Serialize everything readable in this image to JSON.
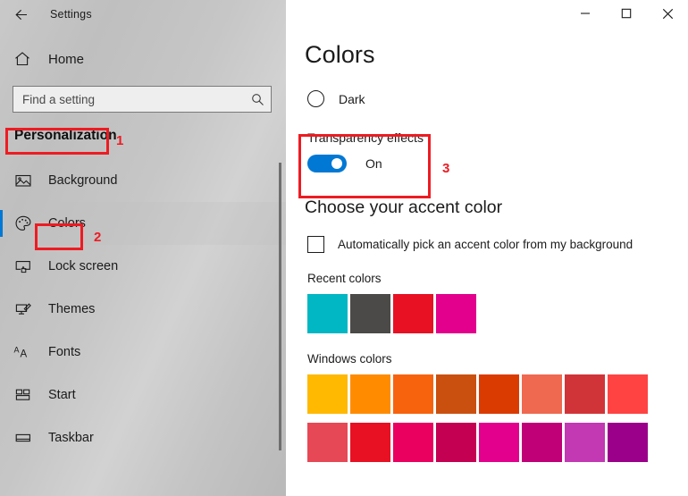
{
  "window": {
    "title": "Settings",
    "back_icon": "back-arrow-icon",
    "minimize_label": "—",
    "maximize_label": "□",
    "close_label": "✕"
  },
  "sidebar": {
    "home": {
      "label": "Home",
      "icon": "home-icon"
    },
    "search": {
      "placeholder": "Find a setting",
      "value": "",
      "icon": "search-icon"
    },
    "category_title": "Personalization",
    "items": [
      {
        "label": "Background",
        "icon": "picture-icon",
        "selected": false
      },
      {
        "label": "Colors",
        "icon": "palette-icon",
        "selected": true
      },
      {
        "label": "Lock screen",
        "icon": "lock-screen-icon",
        "selected": false
      },
      {
        "label": "Themes",
        "icon": "themes-brush-icon",
        "selected": false
      },
      {
        "label": "Fonts",
        "icon": "fonts-aa-icon",
        "selected": false
      },
      {
        "label": "Start",
        "icon": "start-tiles-icon",
        "selected": false
      },
      {
        "label": "Taskbar",
        "icon": "taskbar-icon",
        "selected": false
      }
    ]
  },
  "main": {
    "page_title": "Colors",
    "dark_option": {
      "label": "Dark",
      "checked": false
    },
    "transparency": {
      "label": "Transparency effects",
      "state_label": "On",
      "on": true,
      "accent": "#0078d4"
    },
    "accent_section": {
      "heading": "Choose your accent color",
      "auto_pick": {
        "label": "Automatically pick an accent color from my background",
        "checked": false
      },
      "recent_colors": {
        "label": "Recent colors",
        "swatches": [
          "#00b7c3",
          "#4c4a48",
          "#e81123",
          "#e3008c"
        ]
      },
      "windows_colors": {
        "label": "Windows colors",
        "row1": [
          "#ffb900",
          "#ff8c00",
          "#f7630c",
          "#ca5010",
          "#da3b01",
          "#ef6950",
          "#d13438",
          "#ff4343"
        ],
        "row2": [
          "#e74856",
          "#e81123",
          "#ea005e",
          "#c30052",
          "#e3008c",
          "#bf0077",
          "#c239b3",
          "#9a0089"
        ]
      }
    }
  },
  "annotations": {
    "color": "#ee1b22",
    "markers": [
      {
        "number": "1",
        "target": "personalization-heading"
      },
      {
        "number": "2",
        "target": "colors-nav-item"
      },
      {
        "number": "3",
        "target": "transparency-effects-group"
      }
    ]
  }
}
